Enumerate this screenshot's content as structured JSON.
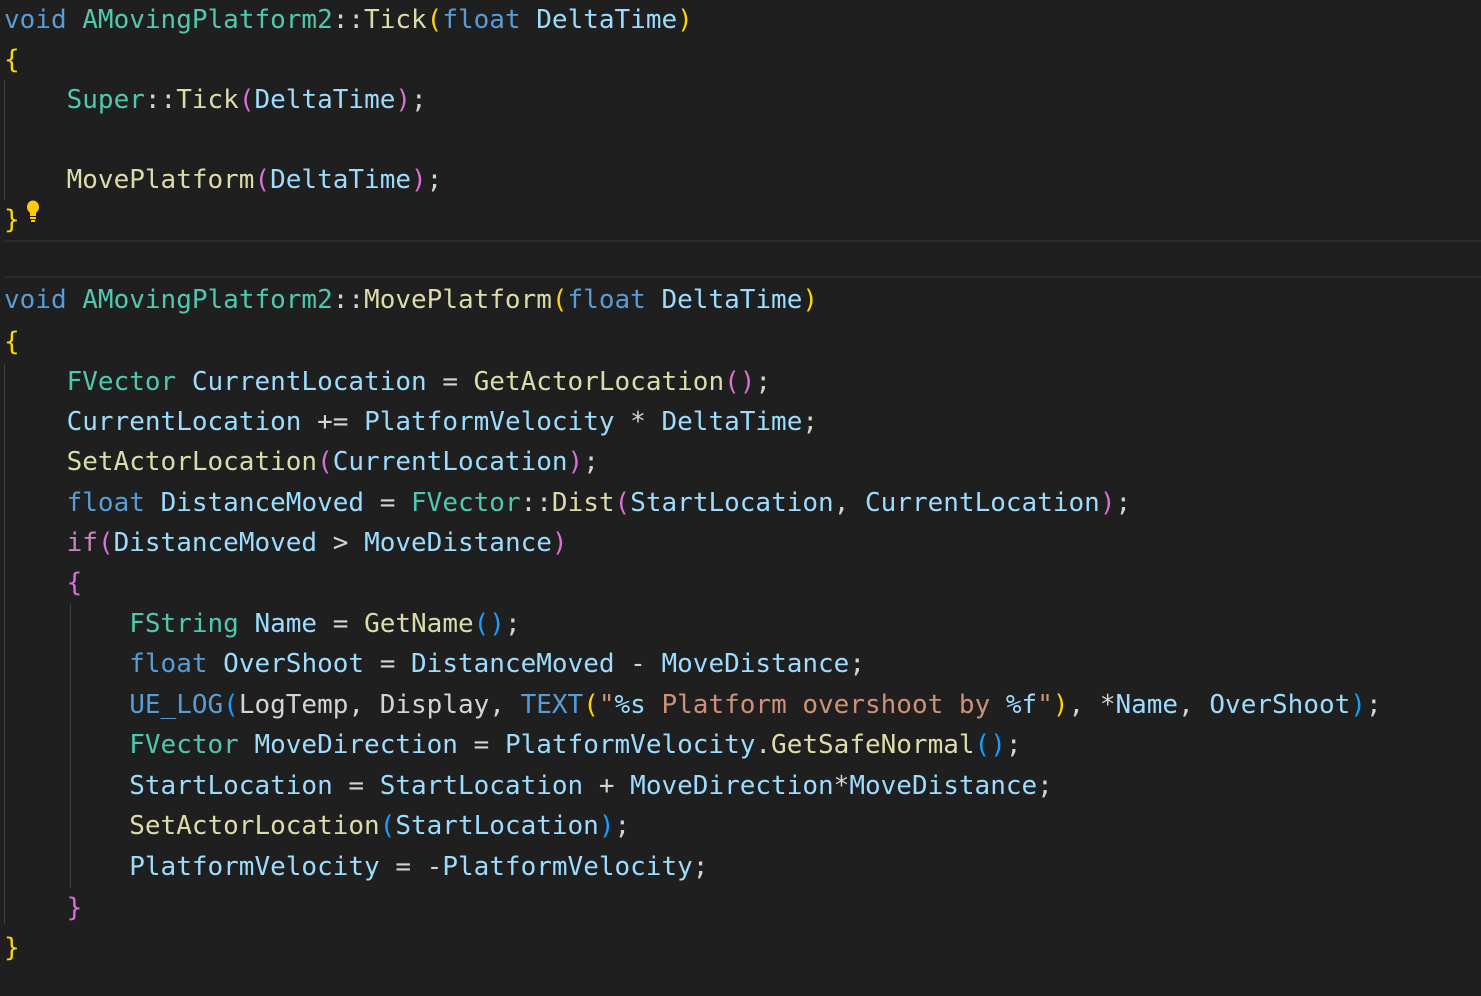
{
  "colors": {
    "background": "#1f1f1f",
    "keyword": "#569cd6",
    "control": "#c586c0",
    "type": "#4ec9b0",
    "function": "#dcdcaa",
    "variable": "#9cdcfe",
    "string": "#ce9178",
    "punctuation": "#d4d4d4",
    "bracket_gold": "#ffd700",
    "bracket_purple": "#da70d6",
    "bracket_blue": "#179fff"
  },
  "icons": {
    "lightbulb": "lightbulb-icon"
  },
  "code_lines": [
    {
      "n": 1,
      "top": 0,
      "tokens": [
        {
          "t": "void",
          "c": "keyword"
        },
        {
          "t": " "
        },
        {
          "t": "AMovingPlatform2",
          "c": "type"
        },
        {
          "t": "::"
        },
        {
          "t": "Tick",
          "c": "function"
        },
        {
          "t": "(",
          "c": "bracket_gold"
        },
        {
          "t": "float",
          "c": "keyword"
        },
        {
          "t": " "
        },
        {
          "t": "DeltaTime",
          "c": "variable"
        },
        {
          "t": ")",
          "c": "bracket_gold"
        }
      ]
    },
    {
      "n": 2,
      "tokens": [
        {
          "t": "{",
          "c": "bracket_gold"
        }
      ]
    },
    {
      "n": 3,
      "tokens": [
        {
          "t": "    "
        },
        {
          "t": "Super",
          "c": "type"
        },
        {
          "t": "::"
        },
        {
          "t": "Tick",
          "c": "function"
        },
        {
          "t": "(",
          "c": "bracket_purple"
        },
        {
          "t": "DeltaTime",
          "c": "variable"
        },
        {
          "t": ")",
          "c": "bracket_purple"
        },
        {
          "t": ";"
        }
      ]
    },
    {
      "n": 4,
      "tokens": [
        {
          "t": ""
        }
      ]
    },
    {
      "n": 5,
      "tokens": [
        {
          "t": "    "
        },
        {
          "t": "MovePlatform",
          "c": "function"
        },
        {
          "t": "(",
          "c": "bracket_purple"
        },
        {
          "t": "DeltaTime",
          "c": "variable"
        },
        {
          "t": ")",
          "c": "bracket_purple"
        },
        {
          "t": ";"
        }
      ]
    },
    {
      "n": 6,
      "tokens": [
        {
          "t": "}",
          "c": "bracket_gold"
        }
      ]
    },
    {
      "n": 7,
      "tokens": [
        {
          "t": ""
        }
      ]
    },
    {
      "n": 8,
      "tokens": [
        {
          "t": "void",
          "c": "keyword"
        },
        {
          "t": " "
        },
        {
          "t": "AMovingPlatform2",
          "c": "type"
        },
        {
          "t": "::"
        },
        {
          "t": "MovePlatform",
          "c": "function"
        },
        {
          "t": "(",
          "c": "bracket_gold"
        },
        {
          "t": "float",
          "c": "keyword"
        },
        {
          "t": " "
        },
        {
          "t": "DeltaTime",
          "c": "variable"
        },
        {
          "t": ")",
          "c": "bracket_gold"
        }
      ]
    },
    {
      "n": 9,
      "tokens": [
        {
          "t": "{",
          "c": "bracket_gold"
        }
      ]
    },
    {
      "n": 10,
      "tokens": [
        {
          "t": "    "
        },
        {
          "t": "FVector",
          "c": "type"
        },
        {
          "t": " "
        },
        {
          "t": "CurrentLocation",
          "c": "variable"
        },
        {
          "t": " = "
        },
        {
          "t": "GetActorLocation",
          "c": "function"
        },
        {
          "t": "(",
          "c": "bracket_purple"
        },
        {
          "t": ")",
          "c": "bracket_purple"
        },
        {
          "t": ";"
        }
      ]
    },
    {
      "n": 11,
      "tokens": [
        {
          "t": "    "
        },
        {
          "t": "CurrentLocation",
          "c": "variable"
        },
        {
          "t": " += "
        },
        {
          "t": "PlatformVelocity",
          "c": "variable"
        },
        {
          "t": " * "
        },
        {
          "t": "DeltaTime",
          "c": "variable"
        },
        {
          "t": ";"
        }
      ]
    },
    {
      "n": 12,
      "tokens": [
        {
          "t": "    "
        },
        {
          "t": "SetActorLocation",
          "c": "function"
        },
        {
          "t": "(",
          "c": "bracket_purple"
        },
        {
          "t": "CurrentLocation",
          "c": "variable"
        },
        {
          "t": ")",
          "c": "bracket_purple"
        },
        {
          "t": ";"
        }
      ]
    },
    {
      "n": 13,
      "tokens": [
        {
          "t": "    "
        },
        {
          "t": "float",
          "c": "keyword"
        },
        {
          "t": " "
        },
        {
          "t": "DistanceMoved",
          "c": "variable"
        },
        {
          "t": " = "
        },
        {
          "t": "FVector",
          "c": "type"
        },
        {
          "t": "::"
        },
        {
          "t": "Dist",
          "c": "function"
        },
        {
          "t": "(",
          "c": "bracket_purple"
        },
        {
          "t": "StartLocation",
          "c": "variable"
        },
        {
          "t": ", "
        },
        {
          "t": "CurrentLocation",
          "c": "variable"
        },
        {
          "t": ")",
          "c": "bracket_purple"
        },
        {
          "t": ";"
        }
      ]
    },
    {
      "n": 14,
      "tokens": [
        {
          "t": "    "
        },
        {
          "t": "if",
          "c": "control"
        },
        {
          "t": "(",
          "c": "bracket_purple"
        },
        {
          "t": "DistanceMoved",
          "c": "variable"
        },
        {
          "t": " > "
        },
        {
          "t": "MoveDistance",
          "c": "variable"
        },
        {
          "t": ")",
          "c": "bracket_purple"
        }
      ]
    },
    {
      "n": 15,
      "tokens": [
        {
          "t": "    "
        },
        {
          "t": "{",
          "c": "bracket_purple"
        }
      ]
    },
    {
      "n": 16,
      "tokens": [
        {
          "t": "        "
        },
        {
          "t": "FString",
          "c": "type"
        },
        {
          "t": " "
        },
        {
          "t": "Name",
          "c": "variable"
        },
        {
          "t": " = "
        },
        {
          "t": "GetName",
          "c": "function"
        },
        {
          "t": "(",
          "c": "bracket_blue"
        },
        {
          "t": ")",
          "c": "bracket_blue"
        },
        {
          "t": ";"
        }
      ]
    },
    {
      "n": 17,
      "tokens": [
        {
          "t": "        "
        },
        {
          "t": "float",
          "c": "keyword"
        },
        {
          "t": " "
        },
        {
          "t": "OverShoot",
          "c": "variable"
        },
        {
          "t": " = "
        },
        {
          "t": "DistanceMoved",
          "c": "variable"
        },
        {
          "t": " - "
        },
        {
          "t": "MoveDistance",
          "c": "variable"
        },
        {
          "t": ";"
        }
      ]
    },
    {
      "n": 18,
      "tokens": [
        {
          "t": "        "
        },
        {
          "t": "UE_LOG",
          "c": "keyword"
        },
        {
          "t": "(",
          "c": "bracket_blue"
        },
        {
          "t": "LogTemp"
        },
        {
          "t": ", "
        },
        {
          "t": "Display"
        },
        {
          "t": ", "
        },
        {
          "t": "TEXT",
          "c": "keyword"
        },
        {
          "t": "(",
          "c": "bracket_gold"
        },
        {
          "t": "\"",
          "c": "string"
        },
        {
          "t": "%s",
          "c": "variable"
        },
        {
          "t": " Platform overshoot by ",
          "c": "string"
        },
        {
          "t": "%f",
          "c": "variable"
        },
        {
          "t": "\"",
          "c": "string"
        },
        {
          "t": ")",
          "c": "bracket_gold"
        },
        {
          "t": ", "
        },
        {
          "t": "*"
        },
        {
          "t": "Name",
          "c": "variable"
        },
        {
          "t": ", "
        },
        {
          "t": "OverShoot",
          "c": "variable"
        },
        {
          "t": ")",
          "c": "bracket_blue"
        },
        {
          "t": ";"
        }
      ]
    },
    {
      "n": 19,
      "tokens": [
        {
          "t": "        "
        },
        {
          "t": "FVector",
          "c": "type"
        },
        {
          "t": " "
        },
        {
          "t": "MoveDirection",
          "c": "variable"
        },
        {
          "t": " = "
        },
        {
          "t": "PlatformVelocity",
          "c": "variable"
        },
        {
          "t": "."
        },
        {
          "t": "GetSafeNormal",
          "c": "function"
        },
        {
          "t": "(",
          "c": "bracket_blue"
        },
        {
          "t": ")",
          "c": "bracket_blue"
        },
        {
          "t": ";"
        }
      ]
    },
    {
      "n": 20,
      "tokens": [
        {
          "t": "        "
        },
        {
          "t": "StartLocation",
          "c": "variable"
        },
        {
          "t": " = "
        },
        {
          "t": "StartLocation",
          "c": "variable"
        },
        {
          "t": " + "
        },
        {
          "t": "MoveDirection",
          "c": "variable"
        },
        {
          "t": "*"
        },
        {
          "t": "MoveDistance",
          "c": "variable"
        },
        {
          "t": ";"
        }
      ]
    },
    {
      "n": 21,
      "tokens": [
        {
          "t": "        "
        },
        {
          "t": "SetActorLocation",
          "c": "function"
        },
        {
          "t": "(",
          "c": "bracket_blue"
        },
        {
          "t": "StartLocation",
          "c": "variable"
        },
        {
          "t": ")",
          "c": "bracket_blue"
        },
        {
          "t": ";"
        }
      ]
    },
    {
      "n": 22,
      "tokens": [
        {
          "t": "        "
        },
        {
          "t": "PlatformVelocity",
          "c": "variable"
        },
        {
          "t": " = "
        },
        {
          "t": "-"
        },
        {
          "t": "PlatformVelocity",
          "c": "variable"
        },
        {
          "t": ";"
        }
      ]
    },
    {
      "n": 23,
      "tokens": [
        {
          "t": "    "
        },
        {
          "t": "}",
          "c": "bracket_purple"
        }
      ]
    },
    {
      "n": 24,
      "tokens": [
        {
          "t": "}",
          "c": "bracket_gold"
        }
      ]
    }
  ]
}
